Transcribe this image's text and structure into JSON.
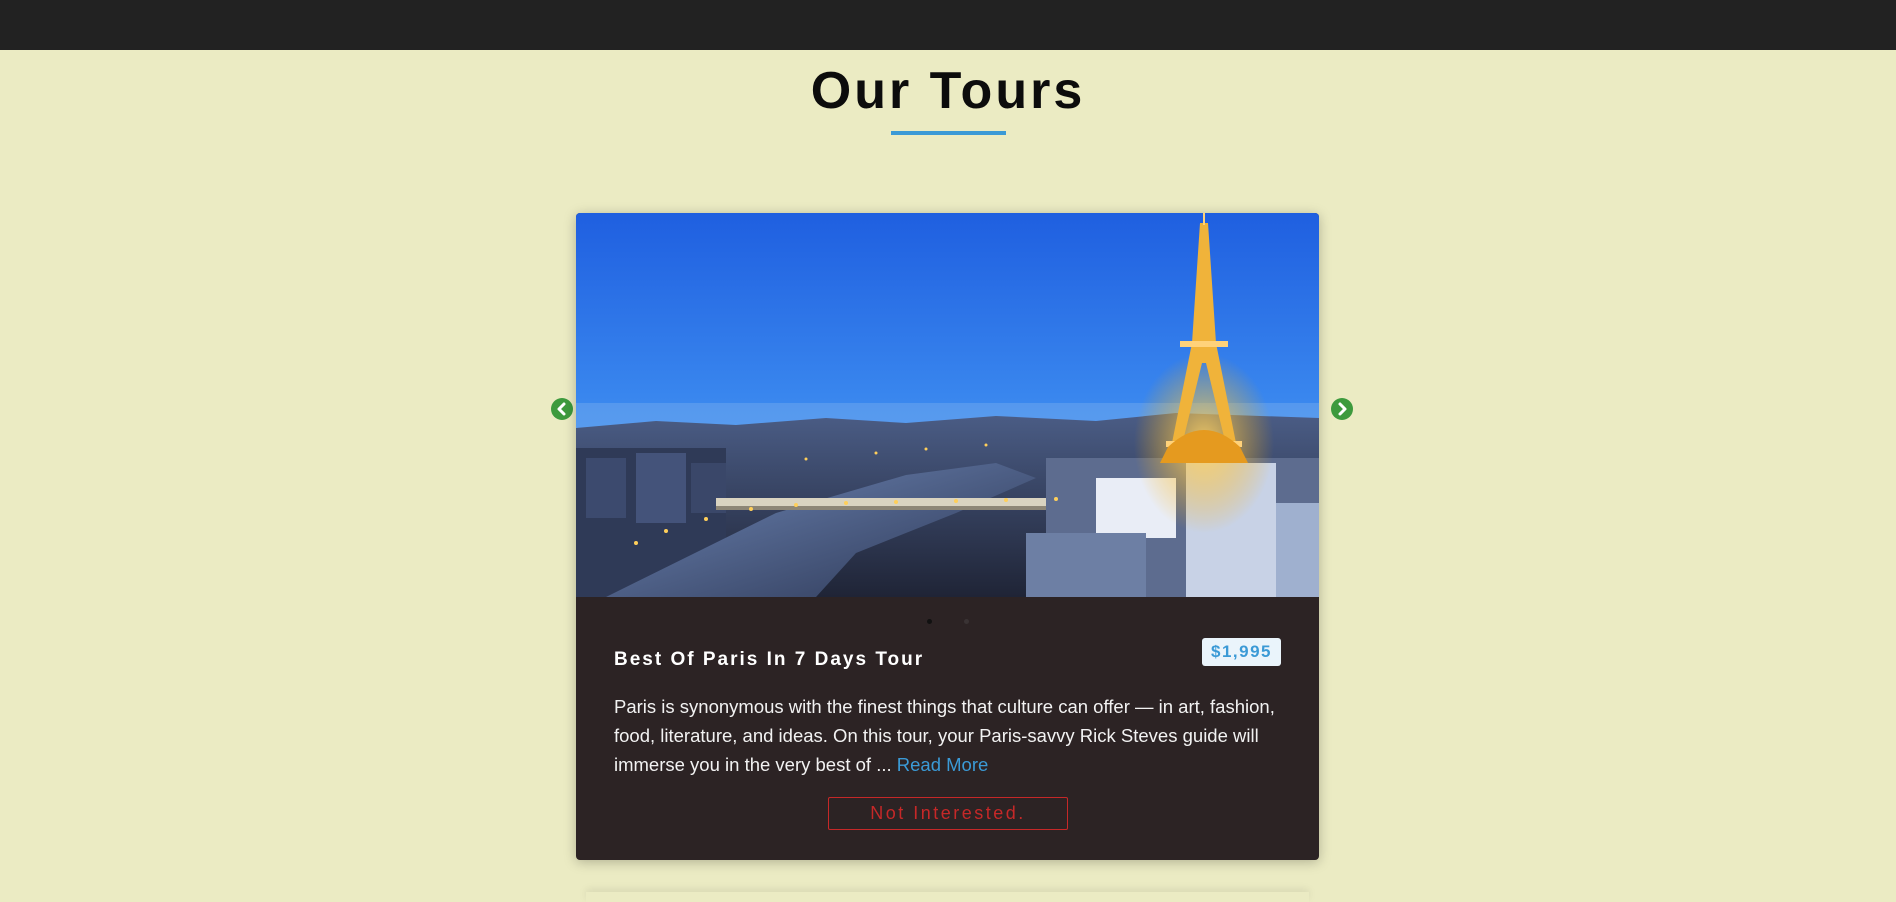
{
  "header": {
    "title": "Our Tours"
  },
  "carousel": {
    "prev_icon": "chevron-left-icon",
    "next_icon": "chevron-right-icon",
    "dot_count": 2,
    "active_dot": 1
  },
  "tour": {
    "name": "Best Of Paris In 7 Days Tour",
    "price": "$1,995",
    "description": "Paris is synonymous with the finest things that culture can offer — in art, fashion, food, literature, and ideas. On this tour, your Paris-savvy Rick Steves guide will immerse you in the very best of ...",
    "read_more_label": "Read More",
    "not_interested_label": "Not Interested."
  },
  "colors": {
    "background": "#ebebc3",
    "topbar": "#222222",
    "accent": "#3b9ad6",
    "card": "#2c2324",
    "danger": "#c62828",
    "arrow": "#3d9a3d"
  }
}
